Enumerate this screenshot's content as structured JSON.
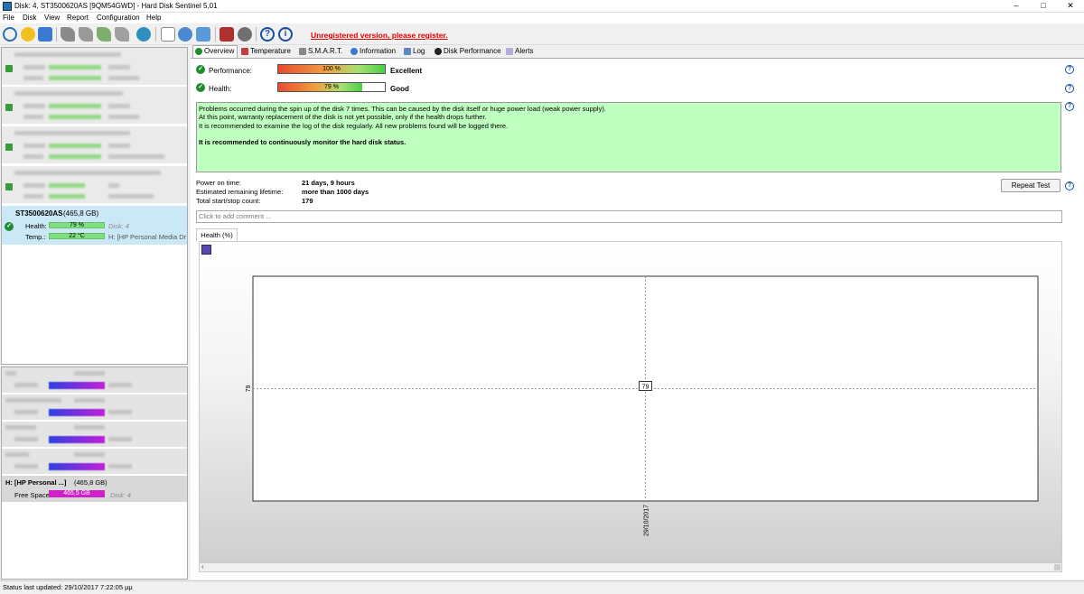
{
  "window": {
    "title": "Disk: 4, ST3500620AS [9QM54GWD]  -  Hard Disk Sentinel 5.01",
    "minimize": "–",
    "maximize": "□",
    "close": "✕"
  },
  "menu": {
    "file": "File",
    "disk": "Disk",
    "view": "View",
    "report": "Report",
    "configuration": "Configuration",
    "help": "Help"
  },
  "toolbar": {
    "unregistered": "Unregistered version, please register."
  },
  "selected_disk": {
    "model": "ST3500620AS",
    "size": "(465,8 GB)",
    "health_label": "Health:",
    "health_value": "79 %",
    "health_percent": 79,
    "disk_label": "Disk: 4",
    "temp_label": "Temp.:",
    "temp_value": "22 °C",
    "drive_label": "H: [HP Personal Media Drive]"
  },
  "selected_volume": {
    "name": "H: [HP Personal ...]",
    "size": "(465,8 GB)",
    "free_label": "Free Space",
    "free_value": "465,5 GB",
    "free_percent": 100,
    "disk_label": "Disk: 4"
  },
  "tabs": {
    "overview": "Overview",
    "temperature": "Temperature",
    "smart": "S.M.A.R.T.",
    "information": "Information",
    "log": "Log",
    "disk_performance": "Disk Performance",
    "alerts": "Alerts"
  },
  "overview": {
    "performance_label": "Performance:",
    "performance_value": "100 %",
    "performance_percent": 100,
    "performance_rating": "Excellent",
    "health_label": "Health:",
    "health_value": "79 %",
    "health_percent": 79,
    "health_rating": "Good",
    "message_lines": [
      "Problems occurred during the spin up of the disk 7 times. This can be caused by the disk itself or huge power load (weak power supply).",
      "At this point, warranty replacement of the disk is not yet possible, only if the health drops further.",
      "It is recommended to examine the log of the disk regularly. All new problems found will be logged there."
    ],
    "message_bold": "It is recommended to continuously monitor the hard disk status.",
    "power_on_label": "Power on time:",
    "power_on_value": "21 days, 9 hours",
    "lifetime_label": "Estimated remaining lifetime:",
    "lifetime_value": "more than 1000 days",
    "startstop_label": "Total start/stop count:",
    "startstop_value": "179",
    "repeat_test": "Repeat Test",
    "comment_placeholder": "Click to add comment ...",
    "chart_tab": "Health (%)"
  },
  "chart_data": {
    "type": "line",
    "title": "Health (%)",
    "x": [
      "29/10/2017"
    ],
    "values": [
      79
    ],
    "ylabel": "",
    "xlabel": "",
    "y_tick": "79",
    "point_label": "79"
  },
  "status": {
    "text": "Status last updated: 29/10/2017 7:22:05 μμ"
  },
  "colors": {
    "ok_green": "#1e8c2f",
    "warn_red": "#e00000",
    "message_bg": "#bfffbf",
    "selected_bg": "#cbe8f6"
  }
}
